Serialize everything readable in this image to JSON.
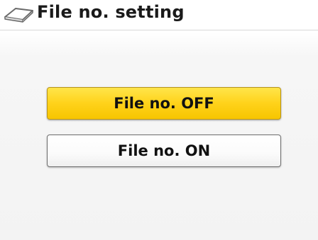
{
  "header": {
    "title": "File no. setting",
    "icon": "photo-paper-icon"
  },
  "options": [
    {
      "label": "File no. OFF",
      "selected": true
    },
    {
      "label": "File no. ON",
      "selected": false
    }
  ],
  "colors": {
    "selected_fill": "#ffd21a",
    "unselected_fill": "#ffffff",
    "title_text": "#1a1a1a"
  }
}
